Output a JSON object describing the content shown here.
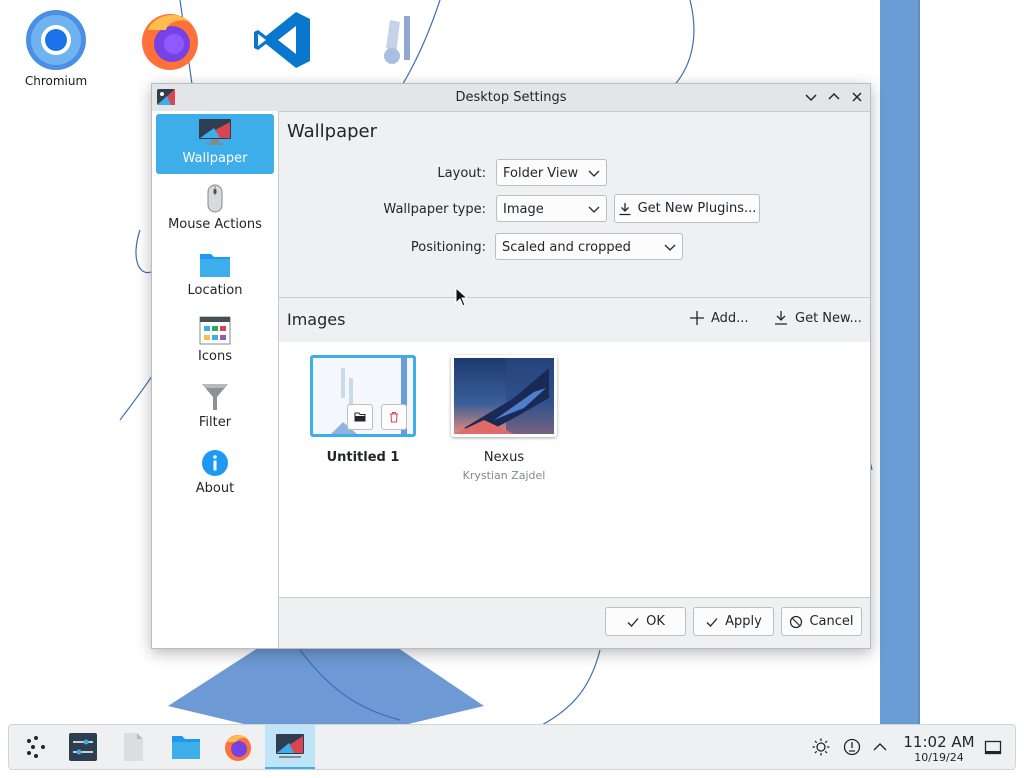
{
  "desktop": {
    "icons": [
      {
        "label": "Chromium",
        "icon": "chromium-icon"
      },
      {
        "label": "",
        "icon": "firefox-icon"
      },
      {
        "label": "",
        "icon": "vscode-icon"
      },
      {
        "label": "",
        "icon": "inkscape-icon"
      }
    ]
  },
  "dialog": {
    "title": "Desktop Settings",
    "titlebar_buttons": [
      "minimize",
      "maximize",
      "close"
    ],
    "sidebar": [
      {
        "label": "Wallpaper",
        "icon": "monitor-icon",
        "active": true
      },
      {
        "label": "Mouse Actions",
        "icon": "mouse-icon",
        "active": false
      },
      {
        "label": "Location",
        "icon": "folder-icon",
        "active": false
      },
      {
        "label": "Icons",
        "icon": "icons-grid-icon",
        "active": false
      },
      {
        "label": "Filter",
        "icon": "filter-icon",
        "active": false
      },
      {
        "label": "About",
        "icon": "info-icon",
        "active": false
      }
    ],
    "page_title": "Wallpaper",
    "form": {
      "layout": {
        "label": "Layout:",
        "value": "Folder View"
      },
      "wallpaper_type": {
        "label": "Wallpaper type:",
        "value": "Image"
      },
      "get_new_plugins": "Get New Plugins...",
      "positioning": {
        "label": "Positioning:",
        "value": "Scaled and cropped"
      }
    },
    "images": {
      "heading": "Images",
      "add_label": "Add...",
      "get_new_label": "Get New...",
      "items": [
        {
          "name": "Untitled 1",
          "author": "",
          "selected": true
        },
        {
          "name": "Nexus",
          "author": "Krystian Zajdel",
          "selected": false
        }
      ]
    },
    "footer": {
      "ok": "OK",
      "apply": "Apply",
      "cancel": "Cancel"
    }
  },
  "taskbar": {
    "items": [
      {
        "icon": "app-launcher-icon",
        "active": false
      },
      {
        "icon": "system-settings-icon",
        "active": false
      },
      {
        "icon": "blank-document-icon",
        "active": false
      },
      {
        "icon": "file-manager-icon",
        "active": false
      },
      {
        "icon": "firefox-icon",
        "active": false
      },
      {
        "icon": "desktop-settings-icon",
        "active": true
      }
    ],
    "tray": [
      "brightness-icon",
      "network-icon",
      "show-hidden-icon"
    ],
    "clock": {
      "time": "11:02 AM",
      "date": "10/19/24"
    }
  },
  "colors": {
    "accent": "#3daee9",
    "wallpaper_blue": "#6a9cd6",
    "window_bg": "#eff0f1"
  }
}
